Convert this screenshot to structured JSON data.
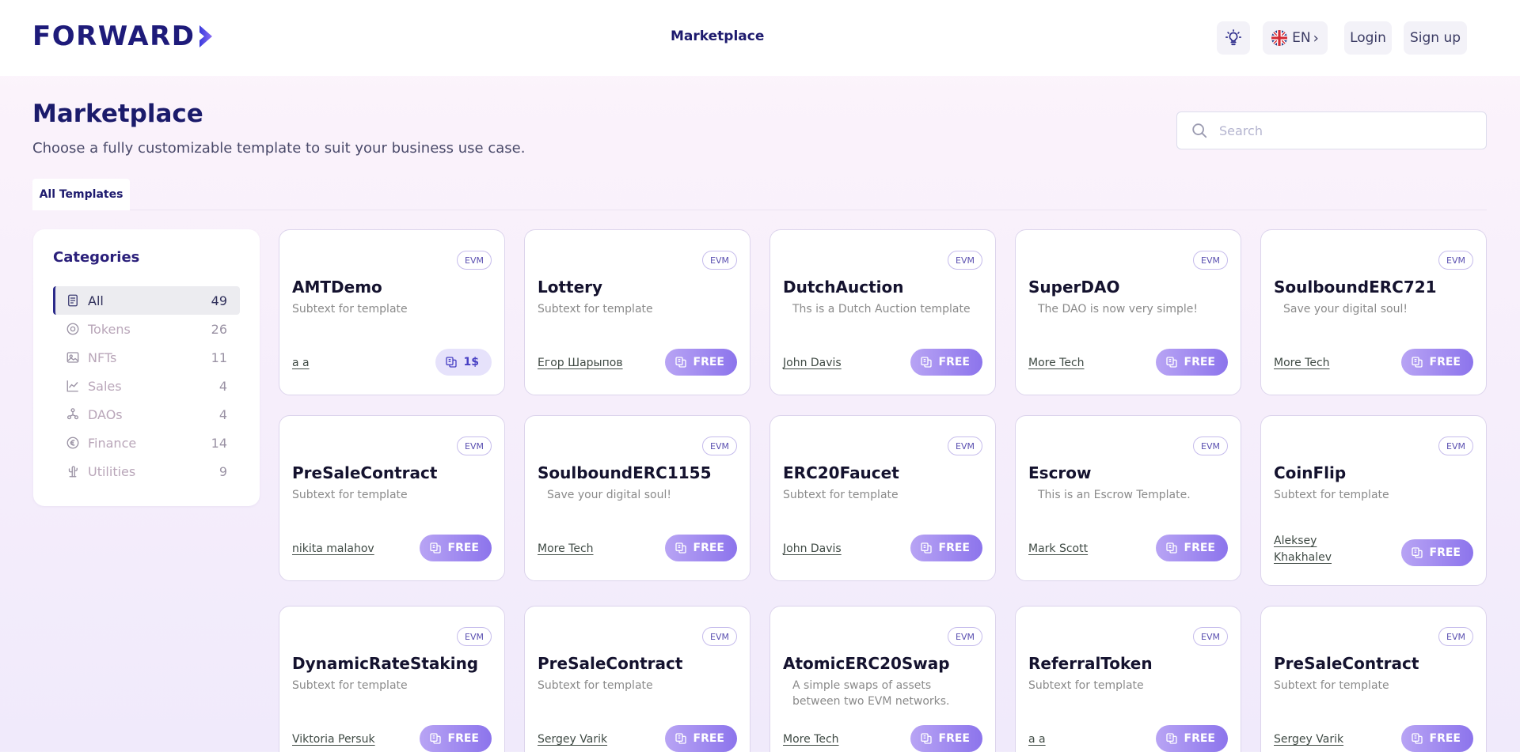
{
  "header": {
    "logo": "FORWARD",
    "nav_link": "Marketplace",
    "lang": "EN",
    "lang_chevron": "›",
    "login": "Login",
    "signup": "Sign up",
    "icons": {
      "theme": "lightbulb-icon",
      "flag": "uk-flag-icon"
    }
  },
  "page": {
    "title": "Marketplace",
    "subtitle": "Choose a fully customizable template to suit your business use case.",
    "search_placeholder": "Search",
    "tab": "All Templates"
  },
  "categories": {
    "title": "Categories",
    "items": [
      {
        "label": "All",
        "count": "49",
        "icon": "document-icon",
        "active": true
      },
      {
        "label": "Tokens",
        "count": "26",
        "icon": "coin-icon",
        "active": false
      },
      {
        "label": "NFTs",
        "count": "11",
        "icon": "image-icon",
        "active": false
      },
      {
        "label": "Sales",
        "count": "4",
        "icon": "chart-icon",
        "active": false
      },
      {
        "label": "DAOs",
        "count": "4",
        "icon": "people-icon",
        "active": false
      },
      {
        "label": "Finance",
        "count": "14",
        "icon": "euro-icon",
        "active": false
      },
      {
        "label": "Utilities",
        "count": "9",
        "icon": "cactus-icon",
        "active": false
      }
    ]
  },
  "cards": [
    {
      "network": "EVM",
      "title": "AMTDemo",
      "subtitle": "Subtext for template",
      "author": "a a",
      "price": "1$",
      "free": false
    },
    {
      "network": "EVM",
      "title": "Lottery",
      "subtitle": "Subtext for template",
      "author": "Егор Шарыпов",
      "price": "FREE",
      "free": true
    },
    {
      "network": "EVM",
      "title": "DutchAuction",
      "subtitle": "Ths is a Dutch Auction template",
      "author": "John Davis",
      "price": "FREE",
      "free": true
    },
    {
      "network": "EVM",
      "title": "SuperDAO",
      "subtitle": "The DAO is now very simple!",
      "author": "More Tech",
      "price": "FREE",
      "free": true
    },
    {
      "network": "EVM",
      "title": "SoulboundERC721",
      "subtitle": "Save your digital soul!",
      "author": "More Tech",
      "price": "FREE",
      "free": true
    },
    {
      "network": "EVM",
      "title": "PreSaleContract",
      "subtitle": "Subtext for template",
      "author": "nikita malahov",
      "price": "FREE",
      "free": true
    },
    {
      "network": "EVM",
      "title": "SoulboundERC1155",
      "subtitle": "Save your digital soul!",
      "author": "More Tech",
      "price": "FREE",
      "free": true
    },
    {
      "network": "EVM",
      "title": "ERC20Faucet",
      "subtitle": "Subtext for template",
      "author": "John Davis",
      "price": "FREE",
      "free": true
    },
    {
      "network": "EVM",
      "title": "Escrow",
      "subtitle": "This is an Escrow Template.",
      "author": "Mark Scott",
      "price": "FREE",
      "free": true
    },
    {
      "network": "EVM",
      "title": "CoinFlip",
      "subtitle": "Subtext for template",
      "author": "Aleksey Khakhalev",
      "price": "FREE",
      "free": true
    },
    {
      "network": "EVM",
      "title": "DynamicRateStaking",
      "subtitle": "Subtext for template",
      "author": "Viktoria Persuk",
      "price": "FREE",
      "free": true
    },
    {
      "network": "EVM",
      "title": "PreSaleContract",
      "subtitle": "Subtext for template",
      "author": "Sergey Varik",
      "price": "FREE",
      "free": true
    },
    {
      "network": "EVM",
      "title": "AtomicERC20Swap",
      "subtitle": "A simple swaps of assets between two EVM networks.",
      "author": "More Tech",
      "price": "FREE",
      "free": true
    },
    {
      "network": "EVM",
      "title": "ReferralToken",
      "subtitle": "Subtext for template",
      "author": "a a",
      "price": "FREE",
      "free": true
    },
    {
      "network": "EVM",
      "title": "PreSaleContract",
      "subtitle": "Subtext for template",
      "author": "Sergey Varik",
      "price": "FREE",
      "free": true
    }
  ]
}
